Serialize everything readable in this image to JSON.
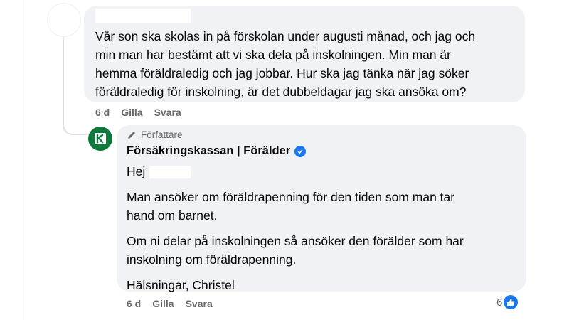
{
  "comment": {
    "text_lines": [
      "Vår son ska skolas in på förskolan under augusti månad, och jag och",
      "min man har bestämt att vi ska dela på inskolningen. Min man är",
      "hemma föräldraledig och jag jobbar. Hur ska jag tänka när jag söker",
      "föräldraledig för inskolning, är det dubbeldagar jag ska ansöka om?"
    ],
    "time": "6 d",
    "like_label": "Gilla",
    "reply_label": "Svara"
  },
  "reply": {
    "author_badge": "Författare",
    "page_name": "Försäkringskassan | Förälder",
    "greeting": "Hej",
    "paragraphs": [
      [
        "Man ansöker om föräldrapenning för den tiden som man tar",
        "hand om barnet."
      ],
      [
        "Om ni delar på inskolningen så ansöker den förälder som har",
        "inskolning om föräldrapenning."
      ],
      [
        "Hälsningar, Christel"
      ]
    ],
    "time": "6 d",
    "like_label": "Gilla",
    "reply_label": "Svara",
    "reaction_count": "6"
  },
  "icons": {
    "author": "pencil-icon",
    "verified": "verified-badge-icon",
    "reaction": "like-thumbs-up-icon",
    "page_avatar": "forsakringskassan-logo"
  },
  "colors": {
    "bubble": "#f0f2f5",
    "meta_text": "#65676b",
    "brand_green": "#0d7a3e",
    "facebook_blue": "#1877f2"
  }
}
